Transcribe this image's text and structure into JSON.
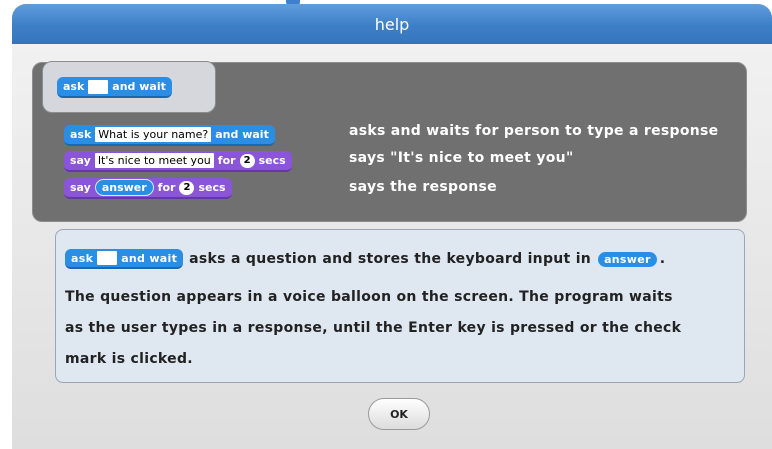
{
  "dialog": {
    "title": "help"
  },
  "hat_block": {
    "before": "ask",
    "after": "and wait"
  },
  "examples": [
    {
      "block": {
        "before": "ask",
        "value": "What is your name?",
        "after": "and wait"
      },
      "description": "asks and waits for person to type a response"
    },
    {
      "block": {
        "before": "say",
        "value": "It's nice to meet you",
        "mid": "for",
        "num": "2",
        "after": "secs"
      },
      "description": "says \"It's nice to meet you\""
    },
    {
      "block": {
        "before": "say",
        "reporter": "answer",
        "mid": "for",
        "num": "2",
        "after": "secs"
      },
      "description": "says the response"
    }
  ],
  "explanation": {
    "block_before": "ask",
    "block_after": "and wait",
    "text_1": "asks a question and stores the keyboard input in",
    "reporter": "answer",
    "period": ".",
    "line_2": "The question appears in a voice balloon on the screen. The program waits",
    "line_3": "as the user types in a response, until the Enter key is pressed or the check",
    "line_4": "mark is clicked."
  },
  "buttons": {
    "ok": "OK"
  },
  "colors": {
    "sensing": "#2a8ee4",
    "looks": "#8a55d7",
    "titlebar": "#3d7fc7"
  }
}
